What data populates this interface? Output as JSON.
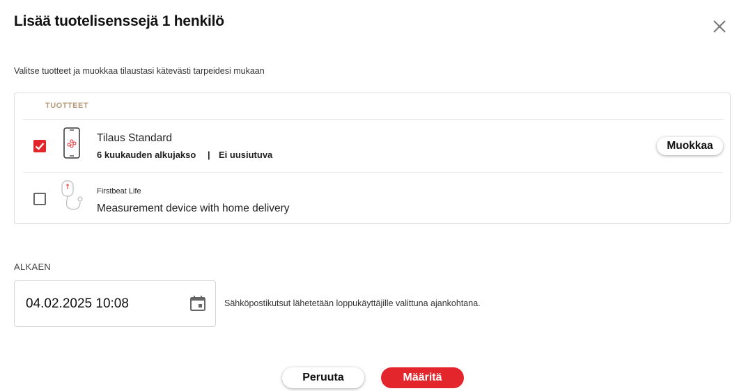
{
  "dialog": {
    "title": "Lisää tuotelisenssejä 1 henkilö",
    "subtitle": "Valitse tuotteet ja muokkaa tilaustasi kätevästi tarpeidesi mukaan",
    "close_icon": "close-icon"
  },
  "products": {
    "column_header": "TUOTTEET",
    "items": [
      {
        "checked": true,
        "icon": "phone-app-icon",
        "name": "Tilaus Standard",
        "meta_left": "6 kuukauden alkujakso",
        "meta_separator": "|",
        "meta_right": "Ei uusiutuva",
        "edit_label": "Muokkaa"
      },
      {
        "checked": false,
        "icon": "measurement-device-icon",
        "brand": "Firstbeat Life",
        "name": "Measurement device with home delivery"
      }
    ]
  },
  "start": {
    "label": "ALKAEN",
    "date_value": "04.02.2025 10:08",
    "calendar_icon": "calendar-icon",
    "note": "Sähköpostikutsut lähetetään loppukäyttäjille valittuna ajankohtana."
  },
  "actions": {
    "cancel_label": "Peruuta",
    "confirm_label": "Määritä"
  },
  "colors": {
    "accent": "#e3262b",
    "header_gold": "#b89a78"
  }
}
